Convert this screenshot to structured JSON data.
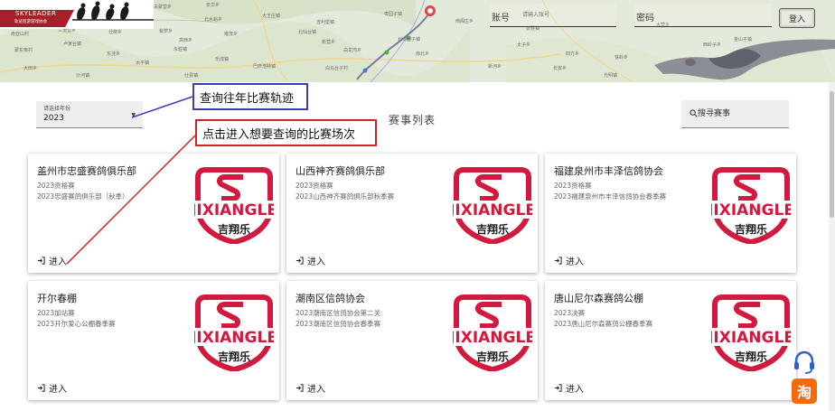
{
  "header": {
    "brand_name": "SKYLEADER",
    "brand_subtitle": "轨迹巡游游戏协会",
    "login": {
      "account_label": "账号",
      "account_placeholder": "请输入账号",
      "password_label": "密码",
      "login_button": "登入"
    },
    "map_labels": [
      "夫蒙营乡",
      "泉华乡",
      "大王庄镇",
      "北水峪乡",
      "吉利堡镇",
      "枣园子镇",
      "南亚山村",
      "三道营乡",
      "仕柳乡",
      "紫萝乡",
      "雍茂乡",
      "北仙台镇",
      "高西乡",
      "新营乡",
      "北马圈子镇",
      "卢家台镇",
      "永胜镇",
      "白龙湾乡",
      "南北乡",
      "蒙东柴村",
      "东洼乡",
      "乐成镇",
      "巴彦浩特镇",
      "大田乡",
      "白马台子村",
      "沙河镇",
      "仕县镇",
      "太平镇",
      "南阁庄乡",
      "太子乡",
      "四方乡",
      "铁岭乡",
      "大营乡",
      "西岭子乡",
      "长安乡",
      "新河乡",
      "光明镇",
      "彭县镇",
      "金山子镇"
    ]
  },
  "toolbar": {
    "year_caption": "请选择年份",
    "year_value": "2023",
    "list_title": "赛事列表",
    "search_placeholder": "搜寻赛事"
  },
  "annotations": {
    "history_hint": "查询往年比赛轨迹",
    "enter_hint": "点击进入想要查询的比赛场次"
  },
  "logo": {
    "word": "JIXIANGLE",
    "cn": "吉翔乐"
  },
  "cards": [
    {
      "title": "盖州市忠盛赛鸽俱乐部",
      "line1": "2023资格赛",
      "line2": "2023忠盛赛鸽俱乐部（秋季）",
      "enter": "进入"
    },
    {
      "title": "山西神齐赛鸽俱乐部",
      "line1": "2023资格赛",
      "line2": "2023山西神齐赛鸽俱乐部秋季赛",
      "enter": "进入"
    },
    {
      "title": "福建泉州市丰泽信鸽协会",
      "line1": "2023资格赛",
      "line2": "2023福建泉州市丰泽信鸽协会春季赛",
      "enter": "进入"
    },
    {
      "title": "开尔春棚",
      "line1": "2023加站赛",
      "line2": "2023开尔爱心公棚春季赛",
      "enter": "进入"
    },
    {
      "title": "潮南区信鸽协会",
      "line1": "2023潮南区信鸽协会第二关",
      "line2": "2023潮南区信鸽协会春季赛",
      "enter": "进入"
    },
    {
      "title": "唐山尼尔森赛鸽公棚",
      "line1": "2023决赛",
      "line2": "2023唐山尼尔森赛鸽公棚春季赛",
      "enter": "进入"
    }
  ],
  "widgets": {
    "taobao_glyph": "淘"
  },
  "colors": {
    "brand_red": "#a61f2b",
    "logo_red": "#d21a3f",
    "annotation_blue": "#3a3fb5",
    "annotation_red": "#d2232a",
    "taobao_orange": "#f66a0e"
  }
}
